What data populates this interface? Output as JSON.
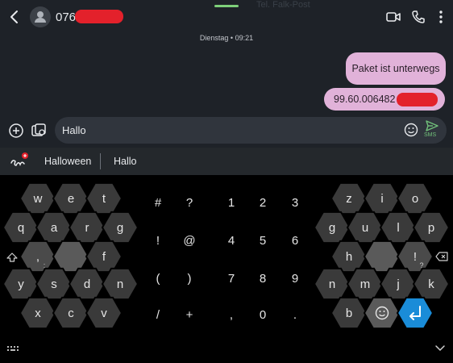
{
  "header": {
    "contact_prefix": "076",
    "ghost_text": "Tel. Falk-Post"
  },
  "conversation": {
    "date_label": "Dienstag • 09:21",
    "messages": [
      {
        "text": "Paket ist unterwegs"
      },
      {
        "text": "99.60.006482"
      }
    ]
  },
  "composer": {
    "input_value": "Hallo",
    "send_label": "SMS"
  },
  "suggestions": {
    "items": [
      "Halloween",
      "Hallo"
    ]
  },
  "keyboard": {
    "left_hex": [
      "w",
      "e",
      "t",
      "q",
      "a",
      "r",
      "g",
      ",",
      "f",
      "y",
      "s",
      "d",
      "n",
      "x",
      "c",
      "v"
    ],
    "left_hex_sub": [
      ":",
      ""
    ],
    "right_hex": [
      "z",
      "i",
      "o",
      "g",
      "u",
      "l",
      "p",
      "h",
      "!",
      "j",
      "m",
      "j",
      "k",
      "b"
    ],
    "right_hex_sub": [
      "?",
      "'"
    ],
    "center_rows": [
      [
        "#",
        "?",
        "1",
        "2",
        "3"
      ],
      [
        "!",
        "@",
        "4",
        "5",
        "6"
      ],
      [
        "(",
        ")",
        "7",
        "8",
        "9"
      ],
      [
        "/",
        "+",
        ",",
        "0",
        "."
      ]
    ]
  },
  "colors": {
    "bubble": "#e1b2d9",
    "accent_green": "#71c07a",
    "enter_blue": "#1a8cd8",
    "hex_key": "#3a3a3a",
    "hex_key_light": "#5a5a5a"
  }
}
